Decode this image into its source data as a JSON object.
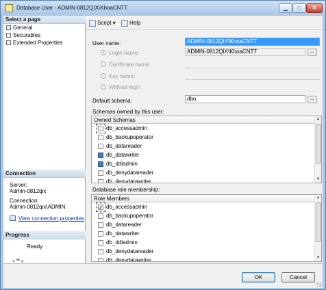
{
  "window": {
    "title": "Database User - ADMIN-0812QIX\\KhoaCNTT"
  },
  "left": {
    "select_page": "Select a page",
    "pages": [
      "General",
      "Securables",
      "Extended Properties"
    ],
    "connection_header": "Connection",
    "server_label": "Server:",
    "server_value": "Admin-0812qix",
    "connection_label": "Connection:",
    "connection_value": "Admin-0812qix\\ADMIN",
    "view_connection": "View connection properties",
    "progress_header": "Progress",
    "progress_status": "Ready"
  },
  "toolbar": {
    "script": "Script",
    "help": "Help"
  },
  "form": {
    "user_name_label": "User name:",
    "user_name_value": "ADMIN-0812QIX\\KhoaCNTT",
    "login_name_label": "Login name:",
    "login_name_value": "ADMIN-0812QIX\\KhoaCNTT",
    "certificate_name_label": "Certificate name:",
    "key_name_label": "Key name:",
    "without_login_label": "Without login",
    "default_schema_label": "Default schema:",
    "default_schema_value": "dbo",
    "ellipsis": "..."
  },
  "schemas": {
    "label": "Schemas owned by this user:",
    "header": "Owned Schemas",
    "items": [
      "db_accessadmin",
      "db_backupoperator",
      "db_datareader",
      "db_datawriter",
      "db_ddladmin",
      "db_denydatareader",
      "db_denydatawriter"
    ]
  },
  "roles": {
    "label": "Database role membership:",
    "header": "Role Members",
    "items": [
      "db_accessadmin",
      "db_backupoperator",
      "db_datareader",
      "db_datawriter",
      "db_ddladmin",
      "db_denydatareader",
      "db_denydatawriter"
    ]
  },
  "buttons": {
    "ok": "OK",
    "cancel": "Cancel"
  }
}
